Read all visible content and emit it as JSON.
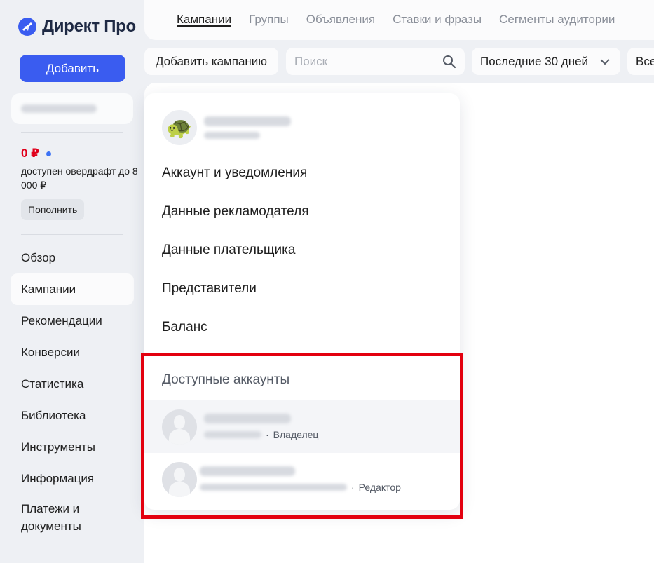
{
  "app": {
    "logo_text": "Директ Про",
    "add_button": "Добавить"
  },
  "sidebar": {
    "balance_amount": "0 ₽",
    "overdraft_text": "доступен овердрафт до 8 000 ₽",
    "topup_button": "Пополнить",
    "nav": [
      {
        "label": "Обзор",
        "active": false
      },
      {
        "label": "Кампании",
        "active": true
      },
      {
        "label": "Рекомендации",
        "active": false
      },
      {
        "label": "Конверсии",
        "active": false
      },
      {
        "label": "Статистика",
        "active": false
      },
      {
        "label": "Библиотека",
        "active": false
      },
      {
        "label": "Инструменты",
        "active": false
      },
      {
        "label": "Информация",
        "active": false
      },
      {
        "label": "Платежи и документы",
        "active": false
      }
    ]
  },
  "tabs": [
    {
      "label": "Кампании",
      "active": true
    },
    {
      "label": "Группы",
      "active": false
    },
    {
      "label": "Объявления",
      "active": false
    },
    {
      "label": "Ставки и фразы",
      "active": false
    },
    {
      "label": "Сегменты аудитории",
      "active": false
    }
  ],
  "toolbar": {
    "add_campaign": "Добавить кампанию",
    "search_placeholder": "Поиск",
    "period": "Последние 30 дней",
    "all_label": "Все"
  },
  "menu": {
    "items": [
      "Аккаунт и уведомления",
      "Данные рекламодателя",
      "Данные плательщика",
      "Представители",
      "Баланс"
    ],
    "accounts_title": "Доступные аккаунты",
    "accounts": [
      {
        "role": "Владелец"
      },
      {
        "role": "Редактор"
      }
    ]
  },
  "colors": {
    "accent": "#3a5cf0",
    "highlight": "#e3000f",
    "balance": "#e0001b"
  }
}
